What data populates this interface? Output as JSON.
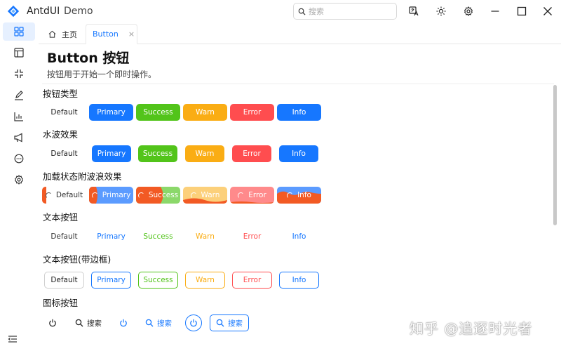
{
  "app": {
    "name": "AntdUI",
    "subtitle": "Demo"
  },
  "search": {
    "placeholder": "搜索"
  },
  "tabs": [
    {
      "label": "主页"
    },
    {
      "label": "Button",
      "close": "×"
    }
  ],
  "page": {
    "title": "Button 按钮",
    "description": "按钮用于开始一个即时操作。"
  },
  "sections": [
    {
      "title": "按钮类型"
    },
    {
      "title": "水波效果"
    },
    {
      "title": "加载状态附波浪效果"
    },
    {
      "title": "文本按钮"
    },
    {
      "title": "文本按钮(带边框)"
    },
    {
      "title": "图标按钮"
    }
  ],
  "buttons": [
    "Default",
    "Primary",
    "Success",
    "Warn",
    "Error",
    "Info"
  ],
  "icon_buttons": {
    "search_label": "搜索"
  },
  "colors": {
    "primary": "#1677ff",
    "success": "#52c41a",
    "warn": "#faad14",
    "error": "#ff4d4f",
    "info": "#1677ff"
  },
  "watermark": "知乎 @追逐时光者"
}
